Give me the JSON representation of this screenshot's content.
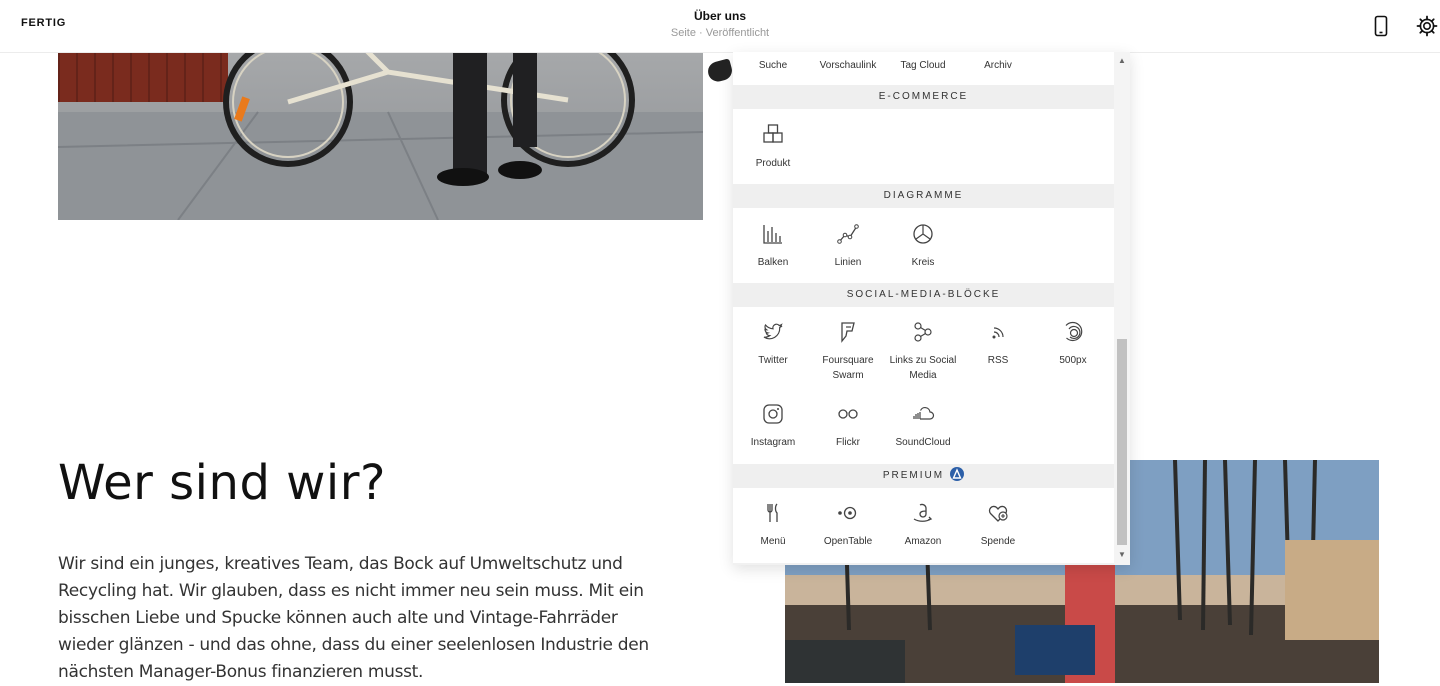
{
  "topbar": {
    "done_label": "FERTIG",
    "title": "Über uns",
    "subtitle": "Seite · Veröffentlicht"
  },
  "content": {
    "heading": "Wer sind wir?",
    "body": "Wir sind ein junges, kreatives Team, das Bock auf Umweltschutz und Recycling hat. Wir glauben, dass es nicht immer neu sein muss. Mit ein bisschen Liebe und Spucke können auch alte und Vintage-Fahrräder wieder glänzen - und das ohne, dass du einer seelenlosen Industrie den nächsten Manager-Bonus finanzieren musst."
  },
  "panel": {
    "top_row": [
      "Suche",
      "Vorschaulink",
      "Tag Cloud",
      "Archiv"
    ],
    "sections": [
      {
        "title": "E-COMMERCE",
        "blocks": [
          {
            "label": "Produkt",
            "icon": "product-icon"
          }
        ]
      },
      {
        "title": "DIAGRAMME",
        "blocks": [
          {
            "label": "Balken",
            "icon": "bar-chart-icon"
          },
          {
            "label": "Linien",
            "icon": "line-chart-icon"
          },
          {
            "label": "Kreis",
            "icon": "pie-chart-icon"
          }
        ]
      },
      {
        "title": "SOCIAL-MEDIA-BLÖCKE",
        "blocks": [
          {
            "label": "Twitter",
            "icon": "twitter-icon"
          },
          {
            "label": "Foursquare Swarm",
            "icon": "foursquare-icon"
          },
          {
            "label": "Links zu Social Media",
            "icon": "social-links-icon"
          },
          {
            "label": "RSS",
            "icon": "rss-icon"
          },
          {
            "label": "500px",
            "icon": "500px-icon"
          },
          {
            "label": "Instagram",
            "icon": "instagram-icon"
          },
          {
            "label": "Flickr",
            "icon": "flickr-icon"
          },
          {
            "label": "SoundCloud",
            "icon": "soundcloud-icon"
          }
        ]
      },
      {
        "title": "PREMIUM",
        "blocks": [
          {
            "label": "Menü",
            "icon": "menu-fork-knife-icon"
          },
          {
            "label": "OpenTable",
            "icon": "opentable-icon"
          },
          {
            "label": "Amazon",
            "icon": "amazon-icon"
          },
          {
            "label": "Spende",
            "icon": "donate-heart-icon"
          }
        ]
      }
    ]
  },
  "colors": {
    "premium_badge": "#2c5fa8",
    "panel_bg": "#f1f1f1"
  }
}
